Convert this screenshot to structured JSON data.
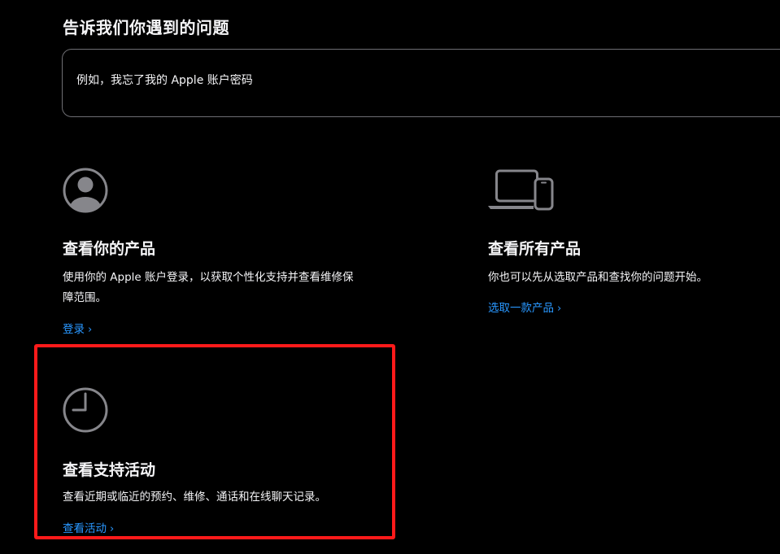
{
  "header": {
    "title": "告诉我们你遇到的问题"
  },
  "search": {
    "placeholder": "例如，我忘了我的 Apple 账户密码"
  },
  "cards": {
    "view_products": {
      "icon": "person-circle-icon",
      "title": "查看你的产品",
      "description": "使用你的 Apple 账户登录，以获取个性化支持并查看维修保障范围。",
      "link": "登录"
    },
    "all_products": {
      "icon": "laptop-phone-icon",
      "title": "查看所有产品",
      "description": "你也可以先从选取产品和查找你的问题开始。",
      "link": "选取一款产品"
    },
    "support_activity": {
      "icon": "clock-icon",
      "title": "查看支持活动",
      "description": "查看近期或临近的预约、维修、通话和在线聊天记录。",
      "link": "查看活动"
    }
  },
  "colors": {
    "background": "#000000",
    "text": "#f5f5f7",
    "link": "#2997ff",
    "icon": "#86868b",
    "highlight": "#ff1a1a"
  }
}
